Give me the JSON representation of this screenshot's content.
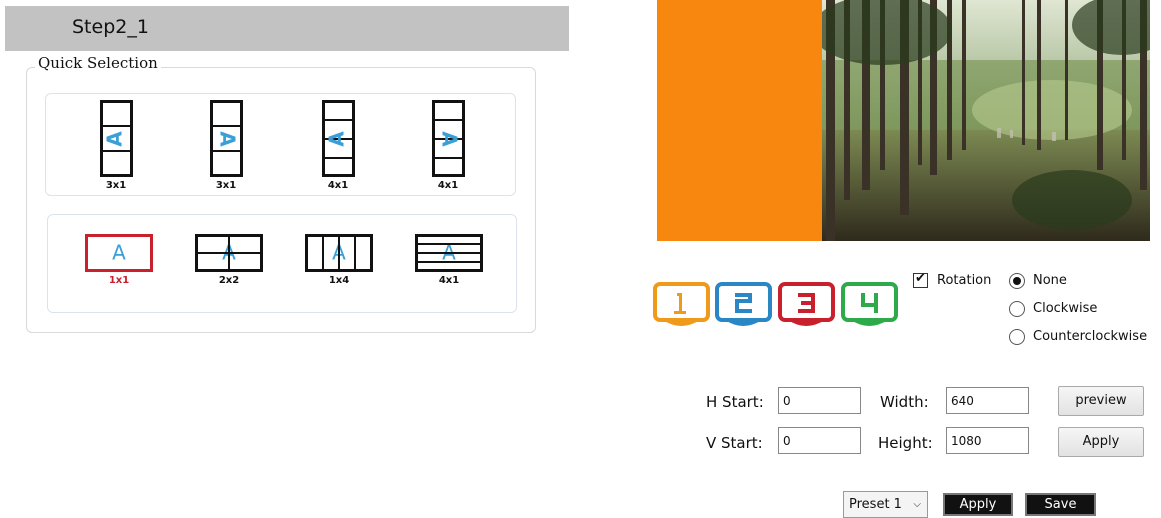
{
  "step": {
    "title": "Step2_1"
  },
  "quick_selection": {
    "legend": "Quick Selection",
    "row1": [
      {
        "label": "3x1",
        "icon": "vertical-strip-rotate-left-icon"
      },
      {
        "label": "3x1",
        "icon": "vertical-strip-rotate-right-icon"
      },
      {
        "label": "4x1",
        "icon": "vertical-strip-4-rotate-left-icon"
      },
      {
        "label": "4x1",
        "icon": "vertical-strip-4-rotate-right-icon"
      }
    ],
    "row2": [
      {
        "label": "1x1",
        "icon": "single-screen-icon",
        "selected": true
      },
      {
        "label": "2x2",
        "icon": "grid-2x2-icon"
      },
      {
        "label": "1x4",
        "icon": "columns-1x4-icon"
      },
      {
        "label": "4x1",
        "icon": "rows-4x1-icon"
      }
    ],
    "letter": "A",
    "accent_color": "#3a9fd6",
    "selected_color": "#c8202c"
  },
  "monitors": [
    {
      "number": "1",
      "color": "#f09a1c"
    },
    {
      "number": "2",
      "color": "#2a86c4"
    },
    {
      "number": "3",
      "color": "#c8202c"
    },
    {
      "number": "4",
      "color": "#2faa4a"
    }
  ],
  "rotation": {
    "label": "Rotation",
    "checked": true,
    "options": [
      "None",
      "Clockwise",
      "Counterclockwise"
    ],
    "selected": "None"
  },
  "position": {
    "h_start_label": "H Start:",
    "h_start_value": "0",
    "v_start_label": "V Start:",
    "v_start_value": "0",
    "width_label": "Width:",
    "width_value": "640",
    "height_label": "Height:",
    "height_value": "1080",
    "preview_button": "preview",
    "apply_button": "Apply"
  },
  "bottom": {
    "preset_value": "Preset 1",
    "apply_button": "Apply",
    "save_button": "Save"
  },
  "preview_colors": {
    "orange": "#f7870f"
  }
}
